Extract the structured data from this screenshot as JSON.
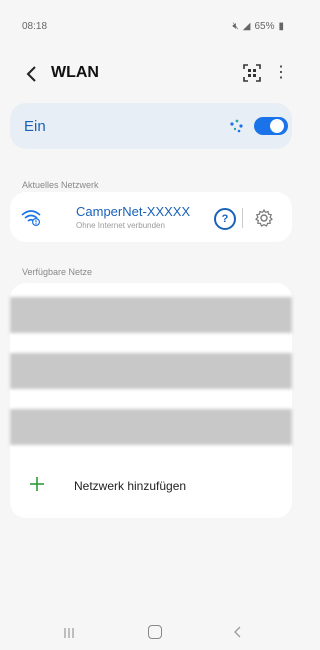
{
  "status_bar": {
    "time": "08:18",
    "battery": "65%"
  },
  "header": {
    "title": "WLAN"
  },
  "wlan_toggle": {
    "label": "Ein",
    "enabled": true
  },
  "current_network": {
    "section_title": "Aktuelles Netzwerk",
    "name": "CamperNet-XXXXX",
    "status": "Ohne Internet verbunden",
    "help_symbol": "?"
  },
  "available_networks": {
    "section_title": "Verfügbare Netze",
    "add_label": "Netzwerk hinzufügen"
  },
  "colors": {
    "accent": "#1a73e8",
    "accent_text": "#1a62b8",
    "add_plus": "#2e9b3a"
  }
}
